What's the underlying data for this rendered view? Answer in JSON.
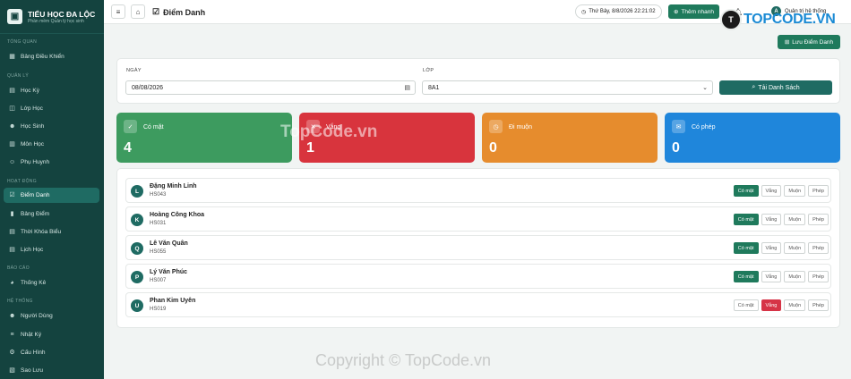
{
  "brand": {
    "title": "TIỂU HỌC ĐA LỘC",
    "subtitle": "Phần mềm Quản lý học sinh"
  },
  "sidebar": {
    "sections": [
      "TỔNG QUAN",
      "QUẢN LÝ",
      "HOẠT ĐỘNG",
      "BÁO CÁO",
      "HỆ THỐNG"
    ],
    "items": [
      {
        "label": "Bảng Điều Khiển",
        "icon": "grid-icon"
      },
      {
        "label": "Học Kỳ",
        "icon": "calendar-icon"
      },
      {
        "label": "Lớp Học",
        "icon": "class-icon"
      },
      {
        "label": "Học Sinh",
        "icon": "students-icon"
      },
      {
        "label": "Môn Học",
        "icon": "book-icon"
      },
      {
        "label": "Phụ Huynh",
        "icon": "parent-icon"
      },
      {
        "label": "Điểm Danh",
        "icon": "check-square-icon",
        "active": true
      },
      {
        "label": "Bảng Điểm",
        "icon": "chart-icon"
      },
      {
        "label": "Thời Khóa Biểu",
        "icon": "timetable-icon"
      },
      {
        "label": "Lịch Học",
        "icon": "schedule-icon"
      },
      {
        "label": "Thống Kê",
        "icon": "pie-icon"
      },
      {
        "label": "Người Dùng",
        "icon": "users-icon"
      },
      {
        "label": "Nhật Ký",
        "icon": "log-icon"
      },
      {
        "label": "Cấu Hình",
        "icon": "gear-icon"
      },
      {
        "label": "Sao Lưu",
        "icon": "backup-icon"
      }
    ]
  },
  "header": {
    "title": "Điểm Danh",
    "datetime": "Thứ Bảy, 8/8/2026 22:21:02",
    "quick_label": "Thêm nhanh",
    "user": {
      "initial": "A",
      "name": "Quản trị hệ thống"
    }
  },
  "save_label": "Lưu Điểm Danh",
  "filter": {
    "date_label": "NGÀY",
    "date_value": "08/08/2026",
    "class_label": "LỚP",
    "class_value": "8A1",
    "load_label": "Tải Danh Sách"
  },
  "stats": [
    {
      "label": "Có mặt",
      "value": "4",
      "color": "#3d9b5f"
    },
    {
      "label": "Vắng",
      "value": "1",
      "color": "#d8343d"
    },
    {
      "label": "Đi muộn",
      "value": "0",
      "color": "#e68c2d"
    },
    {
      "label": "Có phép",
      "value": "0",
      "color": "#1f86db"
    }
  ],
  "students": [
    {
      "initial": "L",
      "name": "Đặng Minh Linh",
      "id": "HS043",
      "status": "present"
    },
    {
      "initial": "K",
      "name": "Hoàng Công Khoa",
      "id": "HS031",
      "status": "present"
    },
    {
      "initial": "Q",
      "name": "Lê Văn Quân",
      "id": "HS055",
      "status": "present"
    },
    {
      "initial": "P",
      "name": "Lý Văn Phúc",
      "id": "HS007",
      "status": "present"
    },
    {
      "initial": "U",
      "name": "Phan Kim Uyên",
      "id": "HS019",
      "status": "absent"
    }
  ],
  "options": [
    "Có mặt",
    "Vắng",
    "Muộn",
    "Phép"
  ],
  "watermark": {
    "overlay": "TopCode.vn",
    "footer": "Copyright © TopCode.vn",
    "logo_text": "TOPCODE.VN"
  }
}
